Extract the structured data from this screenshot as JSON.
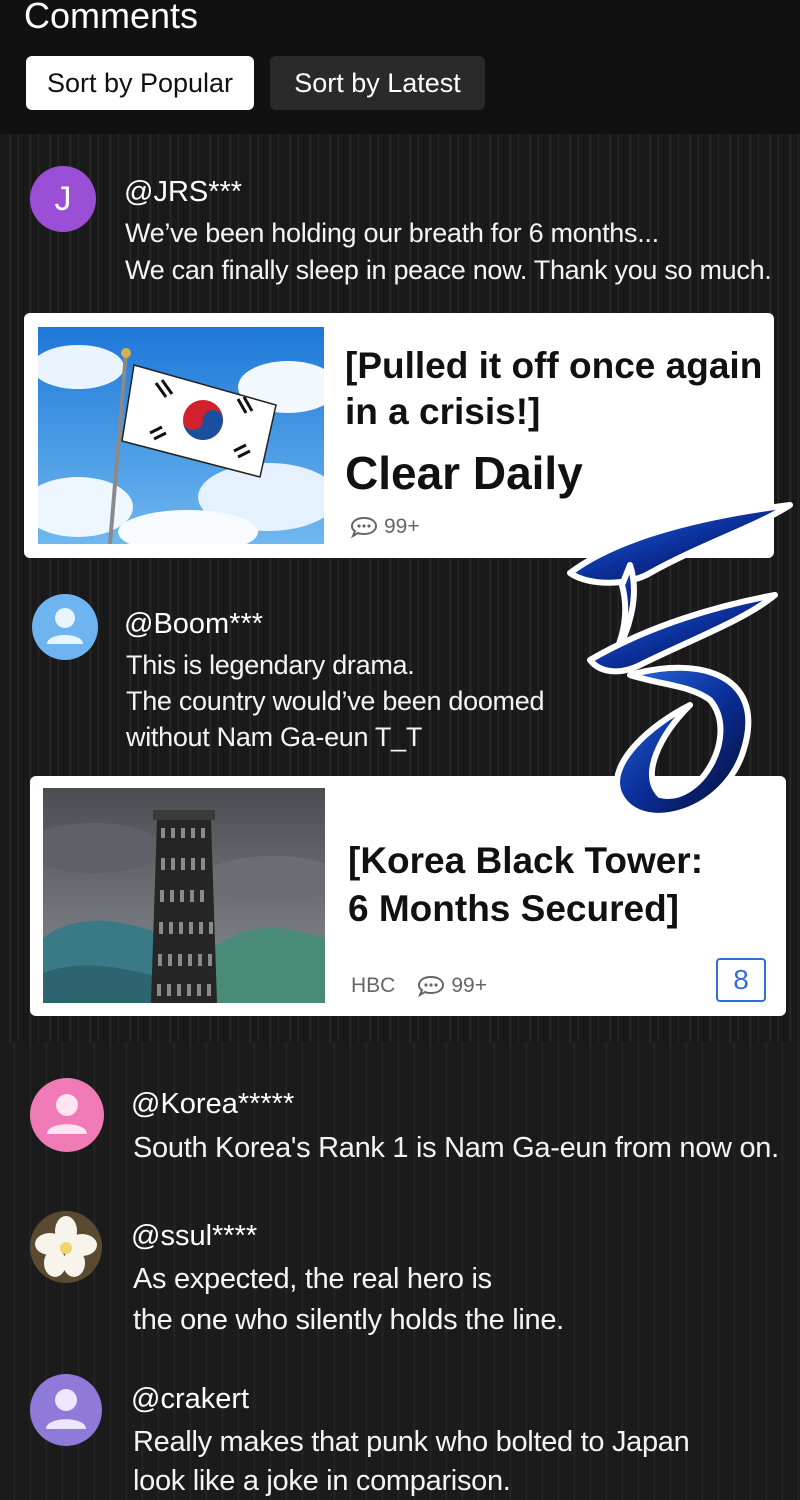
{
  "header": {
    "title": "Comments",
    "sort_popular": "Sort by Popular",
    "sort_latest": "Sort by Latest"
  },
  "comments": [
    {
      "username": "@JRS***",
      "avatar_letter": "J",
      "avatar_color": "#9b4fd6",
      "lines": [
        "We’ve been holding our breath for 6 months...",
        "We can finally sleep in peace now. Thank you so much."
      ]
    },
    {
      "username": "@Boom***",
      "avatar_color": "#6db4f0",
      "lines": [
        "This is legendary drama.",
        "The country would’ve been doomed",
        "without Nam Ga-eun T_T"
      ]
    },
    {
      "username": "@Korea*****",
      "avatar_color": "#f07ab6",
      "lines": [
        "South Korea's Rank 1 is Nam Ga-eun from now on."
      ]
    },
    {
      "username": "@ssul****",
      "avatar_icon": "flower-icon",
      "lines": [
        "As expected, the real hero is",
        "the one who silently holds the line."
      ]
    },
    {
      "username": "@crakert",
      "avatar_color": "#8f7ad9",
      "lines": [
        "Really makes that punk who bolted to Japan",
        "look like a joke in comparison."
      ]
    }
  ],
  "cards": [
    {
      "headline_lines": [
        "[Pulled it off once again",
        "in a crisis!]"
      ],
      "subhead": "Clear Daily",
      "comment_count": "99+",
      "thumb_icon": "korean-flag-icon"
    },
    {
      "headline_lines": [
        "[Korea Black Tower:",
        "6 Months Secured]"
      ],
      "source": "HBC",
      "comment_count": "99+",
      "badge": "8",
      "thumb_icon": "black-tower-icon"
    }
  ],
  "colors": {
    "accent_blue": "#2f6fd6",
    "background": "#121212"
  }
}
